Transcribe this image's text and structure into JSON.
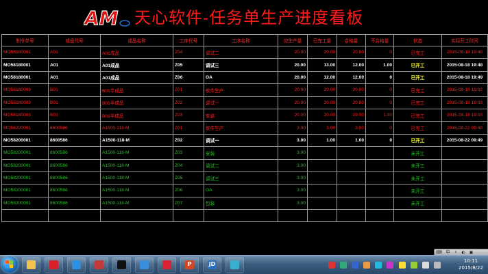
{
  "header": {
    "logo_text": "AM",
    "title": "天心软件-任务单生产进度看板"
  },
  "table": {
    "columns": [
      "制令单号",
      "成品代号",
      "成品名称",
      "工序代号",
      "工序名称",
      "应生产量",
      "已完工量",
      "合格量",
      "不合格量",
      "状态",
      "实际开工时间"
    ],
    "rows": [
      {
        "status_class": "done",
        "cells": [
          "MO58180001",
          "A01",
          "A01成品",
          "Z04",
          "调试二",
          "20.00",
          "20.00",
          "20.00",
          "0",
          "已完工",
          "2015-08-18 19:48"
        ]
      },
      {
        "status_class": "started",
        "cells": [
          "MO58180001",
          "A01",
          "A01成品",
          "Z05",
          "调试三",
          "20.00",
          "13.00",
          "12.00",
          "1.00",
          "已开工",
          "2015-08-18 19:48"
        ]
      },
      {
        "status_class": "started",
        "cells": [
          "MO58180001",
          "A01",
          "A01成品",
          "Z06",
          "OA",
          "20.00",
          "12.00",
          "12.00",
          "0",
          "已开工",
          "2015-08-18 19:49"
        ]
      },
      {
        "status_class": "done",
        "cells": [
          "MO58180003",
          "B01",
          "B01半成品",
          "Z01",
          "软件生产",
          "20.00",
          "20.00",
          "20.00",
          "0",
          "已完工",
          "2015-08-18 19:02"
        ]
      },
      {
        "status_class": "done",
        "cells": [
          "MO58180003",
          "B01",
          "B01半成品",
          "Z02",
          "调试一",
          "20.00",
          "20.00",
          "20.00",
          "0",
          "已完工",
          "2015-08-18 19:03"
        ]
      },
      {
        "status_class": "done",
        "cells": [
          "MO58180003",
          "B01",
          "B01半成品",
          "Z03",
          "安装",
          "20.00",
          "20.00",
          "19.00",
          "1.00",
          "已完工",
          "2015-08-18 19:03"
        ]
      },
      {
        "status_class": "done",
        "cells": [
          "MO58200001",
          "8600586",
          "A1500-118-M",
          "Z01",
          "软件生产",
          "3.00",
          "3.00",
          "3.00",
          "0",
          "已完工",
          "2015-08-22 09:48"
        ]
      },
      {
        "status_class": "started",
        "cells": [
          "MO58200001",
          "8600586",
          "A1500-118-M",
          "Z02",
          "调试一",
          "3.00",
          "1.00",
          "1.00",
          "0",
          "已开工",
          "2015-08-22 09:49"
        ]
      },
      {
        "status_class": "pending",
        "cells": [
          "MO58200001",
          "8600586",
          "A1500-118-M",
          "Z03",
          "安装",
          "3.00",
          "",
          "",
          "",
          "未开工",
          ""
        ]
      },
      {
        "status_class": "pending",
        "cells": [
          "MO58200001",
          "8600586",
          "A1500-118-M",
          "Z04",
          "调试二",
          "3.00",
          "",
          "",
          "",
          "未开工",
          ""
        ]
      },
      {
        "status_class": "pending",
        "cells": [
          "MO58200001",
          "8600586",
          "A1500-118-M",
          "Z05",
          "调试三",
          "3.00",
          "",
          "",
          "",
          "未开工",
          ""
        ]
      },
      {
        "status_class": "pending",
        "cells": [
          "MO58200001",
          "8600586",
          "A1500-118-M",
          "Z06",
          "OA",
          "3.00",
          "",
          "",
          "",
          "未开工",
          ""
        ]
      },
      {
        "status_class": "pending",
        "cells": [
          "MO58200001",
          "8600586",
          "A1500-118-M",
          "Z07",
          "包装",
          "3.00",
          "",
          "",
          "",
          "未开工",
          ""
        ]
      }
    ],
    "empty_rows": 1
  },
  "colors": {
    "done": "#ff2020",
    "started": "#ffffff",
    "started_status": "#ffff33",
    "pending": "#22c322",
    "title": "#ff1a1a"
  },
  "ime": {
    "label": "中"
  },
  "taskbar": {
    "apps": [
      "explorer-icon",
      "store-icon",
      "ie-icon",
      "media-icon",
      "qq-icon",
      "mail-icon",
      "recorder-icon",
      "powerpoint-icon",
      "vs-icon",
      "app-icon"
    ],
    "ppt_label": "P",
    "vs_label": "JD",
    "clock_time": "10:11",
    "clock_date": "2015/8/22"
  }
}
